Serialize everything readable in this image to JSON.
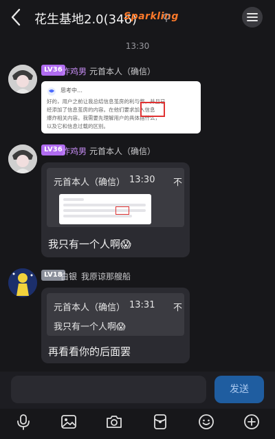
{
  "header": {
    "title": "花生基地2.0(346)",
    "fancy_badge": "Sparkling"
  },
  "timestamp": "13:30",
  "messages": [
    {
      "level": "LV36",
      "nickname": "炸鸡男",
      "sender": "元首本人（确信）",
      "doc_title": "思考中…",
      "doc_text_line1": "好的，用户之前让我总结信息茧房的利与弊，并且已",
      "doc_text_line2": "经添加了信息茧房的内容。在他们要求加入信息",
      "doc_text_line3": "爆炸相关内容。我需要先理解用户的具体指什么，",
      "doc_text_line4": "以及它和信息过载的区别。",
      "highlight": "在他们"
    },
    {
      "level": "LV36",
      "nickname": "炸鸡男",
      "sender": "元首本人（确信）",
      "quote_name": "元首本人（确信）",
      "quote_time": "13:30",
      "quote_flag": "不",
      "text": "我只有一个人啊😱"
    },
    {
      "level": "LV18",
      "nickname": "白银",
      "sender": "我原谅那艘船",
      "quote_name": "元首本人（确信）",
      "quote_time": "13:31",
      "quote_flag": "不",
      "quote_text": "我只有一个人啊😱",
      "text": "再看看你的后面罢"
    }
  ],
  "composer": {
    "input_value": "",
    "send_label": "发送"
  },
  "toolbar_icons": [
    "microphone-icon",
    "image-icon",
    "camera-icon",
    "red-packet-icon",
    "emoji-icon",
    "plus-icon"
  ],
  "colors": {
    "background": "#17171a",
    "accent": "#1f5da0",
    "level_purple": "#b06cf0",
    "level_grey": "#8a8f9a",
    "nick_purple": "#c58bf3"
  }
}
